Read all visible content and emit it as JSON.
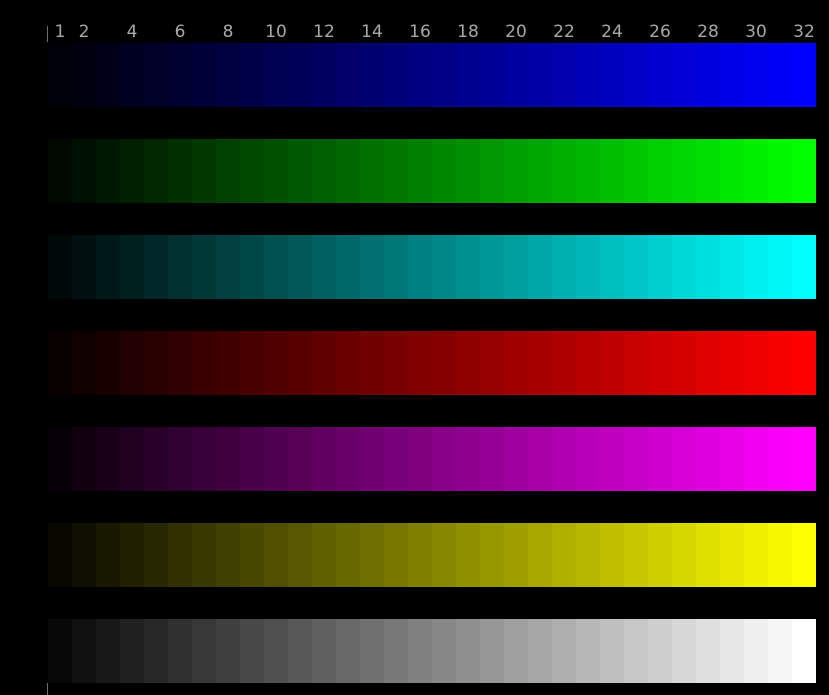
{
  "chart_data": {
    "type": "heatmap",
    "steps": 32,
    "tick_labels": [
      "1",
      "2",
      "4",
      "6",
      "8",
      "10",
      "12",
      "14",
      "16",
      "18",
      "20",
      "22",
      "24",
      "26",
      "28",
      "30",
      "32"
    ],
    "ramps": [
      {
        "color": "#0000ff"
      },
      {
        "color": "#00ff00"
      },
      {
        "color": "#00ffff"
      },
      {
        "color": "#ff0000"
      },
      {
        "color": "#ff00ff"
      },
      {
        "color": "#ffff00"
      },
      {
        "color": "#ffffff"
      }
    ]
  }
}
